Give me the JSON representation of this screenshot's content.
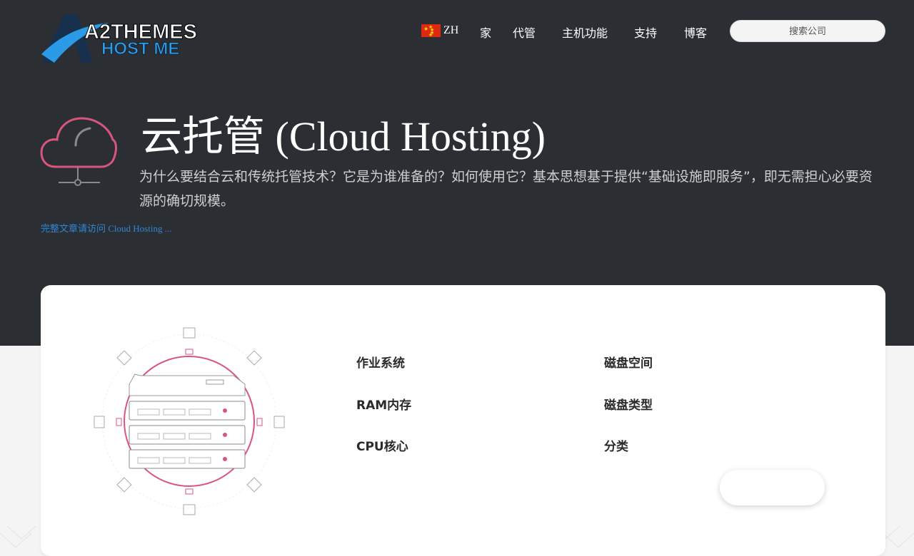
{
  "header": {
    "logo_line1": "A2THEMES",
    "logo_line2": "HOST ME",
    "lang_code": "ZH",
    "nav": [
      {
        "label": "家"
      },
      {
        "label": "代管"
      },
      {
        "label": "主机功能"
      },
      {
        "label": "支持"
      },
      {
        "label": "博客"
      }
    ],
    "search_placeholder": "搜索公司"
  },
  "hero": {
    "title": "云托管 (Cloud Hosting)",
    "intro": "为什么要结合云和传统托管技术？它是为谁准备的？如何使用它？基本思想基于提供“基础设施即服务”，即无需担心必要资源的确切规模。",
    "more_link": "完整文章请访问 Cloud Hosting ..."
  },
  "specs": {
    "os": "作业系统",
    "ram": "RAM内存",
    "cpu": "CPU核心",
    "disk_space": "磁盘空间",
    "disk_type": "磁盘类型",
    "category": "分类"
  },
  "colors": {
    "hero_bg": "#2b2f34",
    "accent_pink": "#d9557d",
    "link_blue": "#2f86d6",
    "logo_blue": "#2b9be8"
  }
}
